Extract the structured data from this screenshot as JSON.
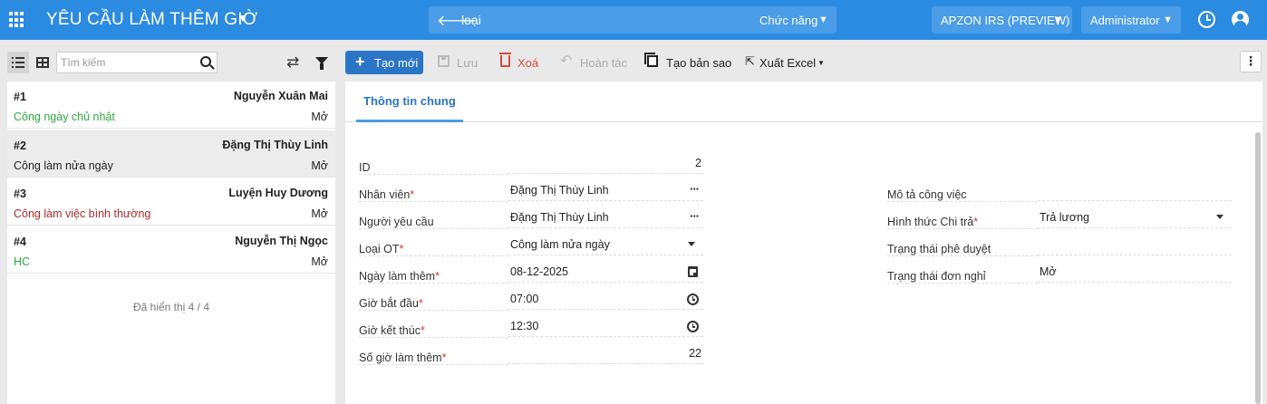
{
  "header": {
    "app_title": "YÊU CẦU LÀM THÊM GIỜ",
    "search_text": "loại",
    "function_label": "Chức năng",
    "tenant_label": "APZON IRS (PREVIEW)",
    "user_label": "Administrator",
    "colors": {
      "bar": "#2b8be0"
    }
  },
  "left_panel": {
    "search_placeholder": "Tìm kiếm",
    "items": [
      {
        "id": "#1",
        "name": "Nguyễn Xuân Mai",
        "type": "Công ngày chủ nhật",
        "type_color": "#2eaa3f",
        "status": "Mở",
        "selected": false
      },
      {
        "id": "#2",
        "name": "Đặng Thị Thùy Linh",
        "type": "Công làm nửa ngày",
        "type_color": "#222222",
        "status": "Mở",
        "selected": true
      },
      {
        "id": "#3",
        "name": "Luyện Huy Dương",
        "type": "Công làm việc bình thường",
        "type_color": "#b02a2a",
        "status": "Mở",
        "selected": false
      },
      {
        "id": "#4",
        "name": "Nguyễn Thị Ngọc",
        "type": "HC",
        "type_color": "#2eaa3f",
        "status": "Mở",
        "selected": false
      }
    ],
    "footer": "Đã hiển thị 4 / 4"
  },
  "toolbar": {
    "new_label": "Tạo mới",
    "save_label": "Lưu",
    "delete_label": "Xoá",
    "undo_label": "Hoàn tác",
    "copy_label": "Tạo bản sao",
    "export_label": "Xuất Excel"
  },
  "tabs": {
    "general": "Thông tin chung"
  },
  "form": {
    "id": {
      "label": "ID",
      "value": "2"
    },
    "employee": {
      "label": "Nhân viên",
      "value": "Đặng Thị Thùy Linh"
    },
    "requester": {
      "label": "Người yêu cầu",
      "value": "Đặng Thị Thùy Linh"
    },
    "ot_type": {
      "label": "Loại OT",
      "value": "Công làm nửa ngày"
    },
    "ot_date": {
      "label": "Ngày làm thêm",
      "value": "08-12-2025"
    },
    "start_time": {
      "label": "Giờ bắt đầu",
      "value": "07:00"
    },
    "end_time": {
      "label": "Giờ kết thúc",
      "value": "12:30"
    },
    "ot_hours": {
      "label": "Số giờ làm thêm",
      "value": "22"
    },
    "job_desc": {
      "label": "Mô tả công việc",
      "value": ""
    },
    "payment": {
      "label": "Hình thức Chi trả",
      "value": "Trả lương"
    },
    "approval_status": {
      "label": "Trạng thái phê duyệt",
      "value": ""
    },
    "leave_status": {
      "label": "Trạng thái đơn nghỉ",
      "value": "Mở"
    }
  }
}
